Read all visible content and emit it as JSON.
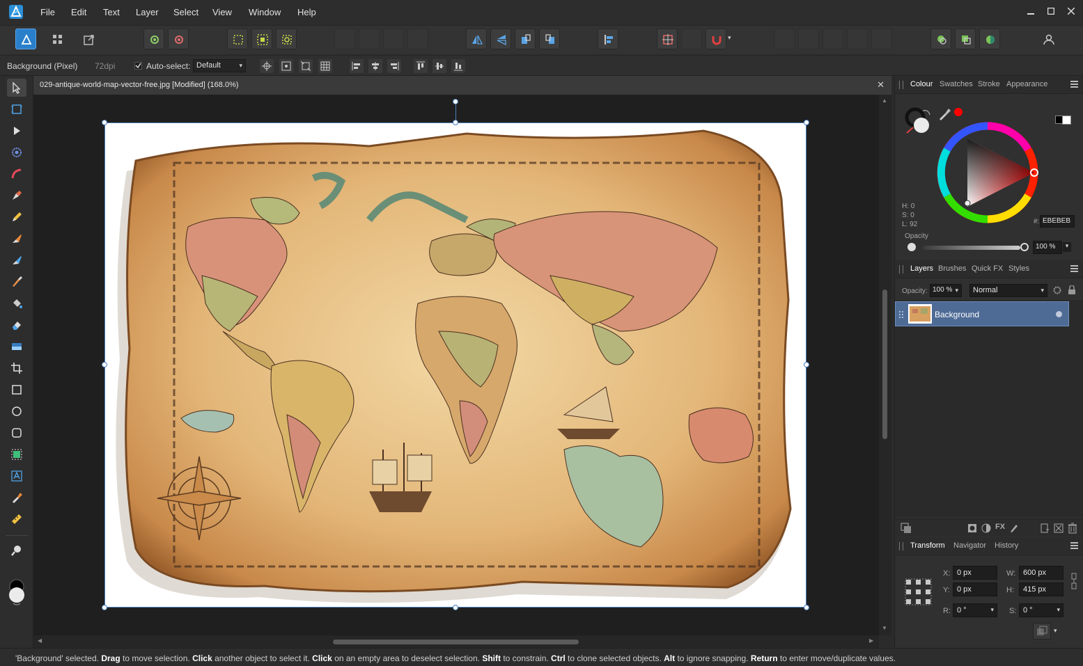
{
  "menu": {
    "items": [
      "File",
      "Edit",
      "Text",
      "Layer",
      "Select",
      "View",
      "Window",
      "Help"
    ]
  },
  "context": {
    "layer_info": "Background (Pixel)",
    "dpi": "72dpi",
    "auto_select_label": "Auto-select:",
    "auto_select_value": "Default"
  },
  "document": {
    "title": "029-antique-world-map-vector-free.jpg [Modified] (168.0%)",
    "close": "✕"
  },
  "colour_panel": {
    "tabs": [
      "Colour",
      "Swatches",
      "Stroke",
      "Appearance"
    ],
    "h": "H: 0",
    "s": "S: 0",
    "l": "L: 92",
    "hex_label": "#:",
    "hex_value": "EBEBEB",
    "opacity_label": "Opacity",
    "opacity_value": "100 %",
    "accent_color": "#ff0000"
  },
  "layers_panel": {
    "tabs": [
      "Layers",
      "Brushes",
      "Quick FX",
      "Styles"
    ],
    "opacity_label": "Opacity:",
    "opacity_value": "100 %",
    "blend_mode": "Normal",
    "layers": [
      {
        "name": "Background"
      }
    ]
  },
  "transform_panel": {
    "tabs": [
      "Transform",
      "Navigator",
      "History"
    ],
    "x_label": "X:",
    "x_value": "0 px",
    "y_label": "Y:",
    "y_value": "0 px",
    "w_label": "W:",
    "w_value": "600 px",
    "h_label": "H:",
    "h_value": "415 px",
    "r_label": "R:",
    "r_value": "0 °",
    "s_label": "S:",
    "s_value": "0 °"
  },
  "status": {
    "segments": [
      {
        "t": "'Background' selected. ",
        "b": false
      },
      {
        "t": "Drag",
        "b": true
      },
      {
        "t": " to move selection. ",
        "b": false
      },
      {
        "t": "Click",
        "b": true
      },
      {
        "t": " another object to select it. ",
        "b": false
      },
      {
        "t": "Click",
        "b": true
      },
      {
        "t": " on an empty area to deselect selection. ",
        "b": false
      },
      {
        "t": "Shift",
        "b": true
      },
      {
        "t": " to constrain. ",
        "b": false
      },
      {
        "t": "Ctrl",
        "b": true
      },
      {
        "t": " to clone selected objects. ",
        "b": false
      },
      {
        "t": "Alt",
        "b": true
      },
      {
        "t": " to ignore snapping. ",
        "b": false
      },
      {
        "t": "Return",
        "b": true
      },
      {
        "t": " to enter move/duplicate values.",
        "b": false
      }
    ]
  }
}
